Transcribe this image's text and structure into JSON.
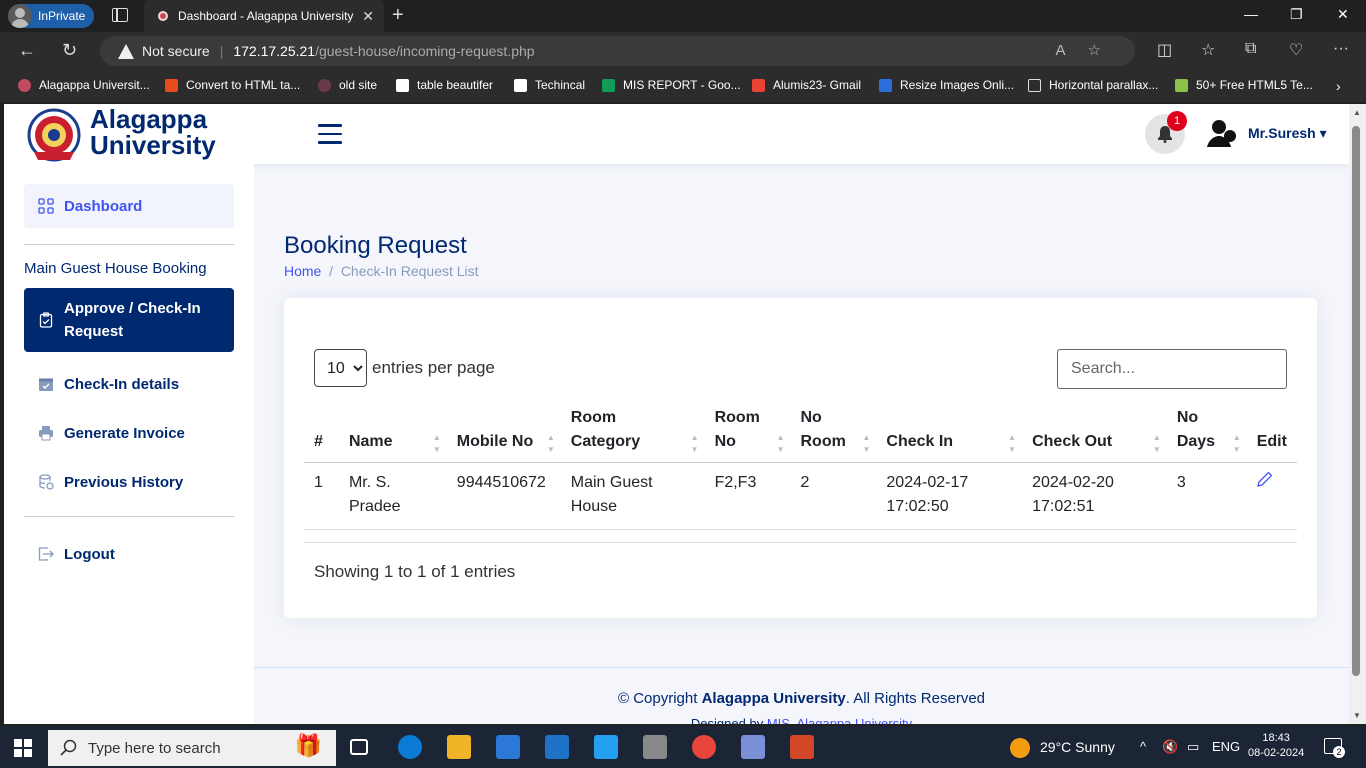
{
  "browser": {
    "inprivate_label": "InPrivate",
    "tab_title": "Dashboard - Alagappa University",
    "not_secure": "Not secure",
    "url_host": "172.17.25.21",
    "url_path": "/guest-house/incoming-request.php"
  },
  "bookmarks": [
    {
      "label": "Alagappa Universit...",
      "color": "#c04a5e"
    },
    {
      "label": "Convert to HTML ta...",
      "color": "#e84c1e"
    },
    {
      "label": "old site",
      "color": "#6a3a4a"
    },
    {
      "label": "table beautifer",
      "color": "#ffffff"
    },
    {
      "label": "Techincal",
      "color": "#ffffff"
    },
    {
      "label": "MIS REPORT - Goo...",
      "color": "#0f9d58"
    },
    {
      "label": "Alumis23- Gmail",
      "color": "#ea4335"
    },
    {
      "label": "Resize Images Onli...",
      "color": "#2a6fdb"
    },
    {
      "label": "Horizontal parallax...",
      "color": "#dddddd"
    },
    {
      "label": "50+ Free HTML5 Te...",
      "color": "#8bc34a"
    }
  ],
  "header": {
    "logo_line1": "Alagappa",
    "logo_line2": "University",
    "notification_count": "1",
    "user_name": "Mr.Suresh"
  },
  "sidebar": {
    "dashboard": "Dashboard",
    "section_heading": "Main Guest House Booking",
    "approve": "Approve / Check-In Request",
    "checkin_details": "Check-In details",
    "generate_invoice": "Generate Invoice",
    "previous_history": "Previous History",
    "logout": "Logout"
  },
  "main": {
    "title": "Booking Request",
    "breadcrumb_home": "Home",
    "breadcrumb_sep": "/",
    "breadcrumb_current": "Check-In Request List",
    "entries_value": "10",
    "entries_label": "entries per page",
    "search_placeholder": "Search...",
    "columns": [
      "#",
      "Name",
      "Mobile No",
      "Room Category",
      "Room No",
      "No Room",
      "Check In",
      "Check Out",
      "No Days",
      "Edit"
    ],
    "rows": [
      {
        "num": "1",
        "name": "Mr. S. Pradee",
        "mobile": "9944510672",
        "category": "Main Guest House",
        "room_no": "F2,F3",
        "no_room": "2",
        "check_in": "2024-02-17 17:02:50",
        "check_out": "2024-02-20 17:02:51",
        "no_days": "3"
      }
    ],
    "showing": "Showing 1 to 1 of 1 entries"
  },
  "footer": {
    "copyright_prefix": "© Copyright",
    "copyright_name": "Alagappa University",
    "copyright_suffix": ". All Rights Reserved",
    "designed_prefix": "Designed by",
    "designed_name": "MIS, Alagappa University"
  },
  "taskbar": {
    "search_placeholder": "Type here to search",
    "weather": "29°C  Sunny",
    "lang": "ENG",
    "time": "18:43",
    "date": "08-02-2024",
    "notif_count": "2"
  },
  "colors": {
    "primary": "#012970",
    "accent": "#4154f1",
    "badge": "#e0001b"
  }
}
